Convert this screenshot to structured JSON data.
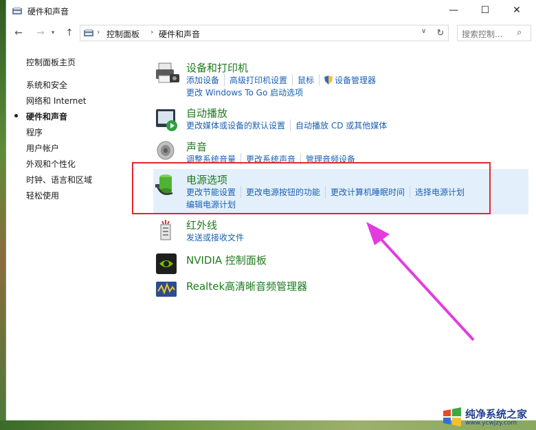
{
  "window": {
    "title": "硬件和声音"
  },
  "controls": {
    "minimize": "—",
    "maximize": "☐",
    "close": "✕"
  },
  "navbar": {
    "back": "←",
    "forward": "→",
    "recent": "▾",
    "up": "↑",
    "breadcrumbs": [
      "控制面板",
      "硬件和声音"
    ],
    "separator": "›",
    "dropdown": "∨",
    "refresh": "↻",
    "search_placeholder": "搜索控制...",
    "search_icon": "⌕"
  },
  "sidebar": {
    "items": [
      {
        "label": "控制面板主页"
      },
      {
        "label": "系统和安全"
      },
      {
        "label": "网络和 Internet"
      },
      {
        "label": "硬件和声音",
        "active": true
      },
      {
        "label": "程序"
      },
      {
        "label": "用户帐户"
      },
      {
        "label": "外观和个性化"
      },
      {
        "label": "时钟、语言和区域"
      },
      {
        "label": "轻松使用"
      }
    ]
  },
  "categories": [
    {
      "title": "设备和打印机",
      "icon": "printer-icon",
      "links": [
        "添加设备",
        "高级打印机设置",
        "鼠标",
        "设备管理器"
      ],
      "links2": "更改 Windows To Go 启动选项"
    },
    {
      "title": "自动播放",
      "icon": "autoplay-icon",
      "links": [
        "更改媒体或设备的默认设置",
        "自动播放 CD 或其他媒体"
      ]
    },
    {
      "title": "声音",
      "icon": "speaker-icon",
      "links": [
        "调整系统音量",
        "更改系统声音",
        "管理音频设备"
      ]
    },
    {
      "title": "电源选项",
      "icon": "battery-icon",
      "links": [
        "更改节能设置",
        "更改电源按钮的功能",
        "更改计算机睡眠时间",
        "选择电源计划"
      ],
      "links2": "编辑电源计划"
    },
    {
      "title": "红外线",
      "icon": "infrared-icon",
      "links": [
        "发送或接收文件"
      ]
    },
    {
      "title": "NVIDIA 控制面板",
      "icon": "nvidia-icon",
      "links": []
    },
    {
      "title": "Realtek高清晰音频管理器",
      "icon": "realtek-icon",
      "links": []
    }
  ],
  "watermark": {
    "text": "纯净系统之家",
    "url": "www.ycwjzy.com"
  },
  "colors": {
    "link": "#1a5fb4",
    "category_title": "#1e7a1e",
    "highlight": "#e3f0fb",
    "annotation": "#e0282a",
    "arrow": "#e33be0"
  }
}
